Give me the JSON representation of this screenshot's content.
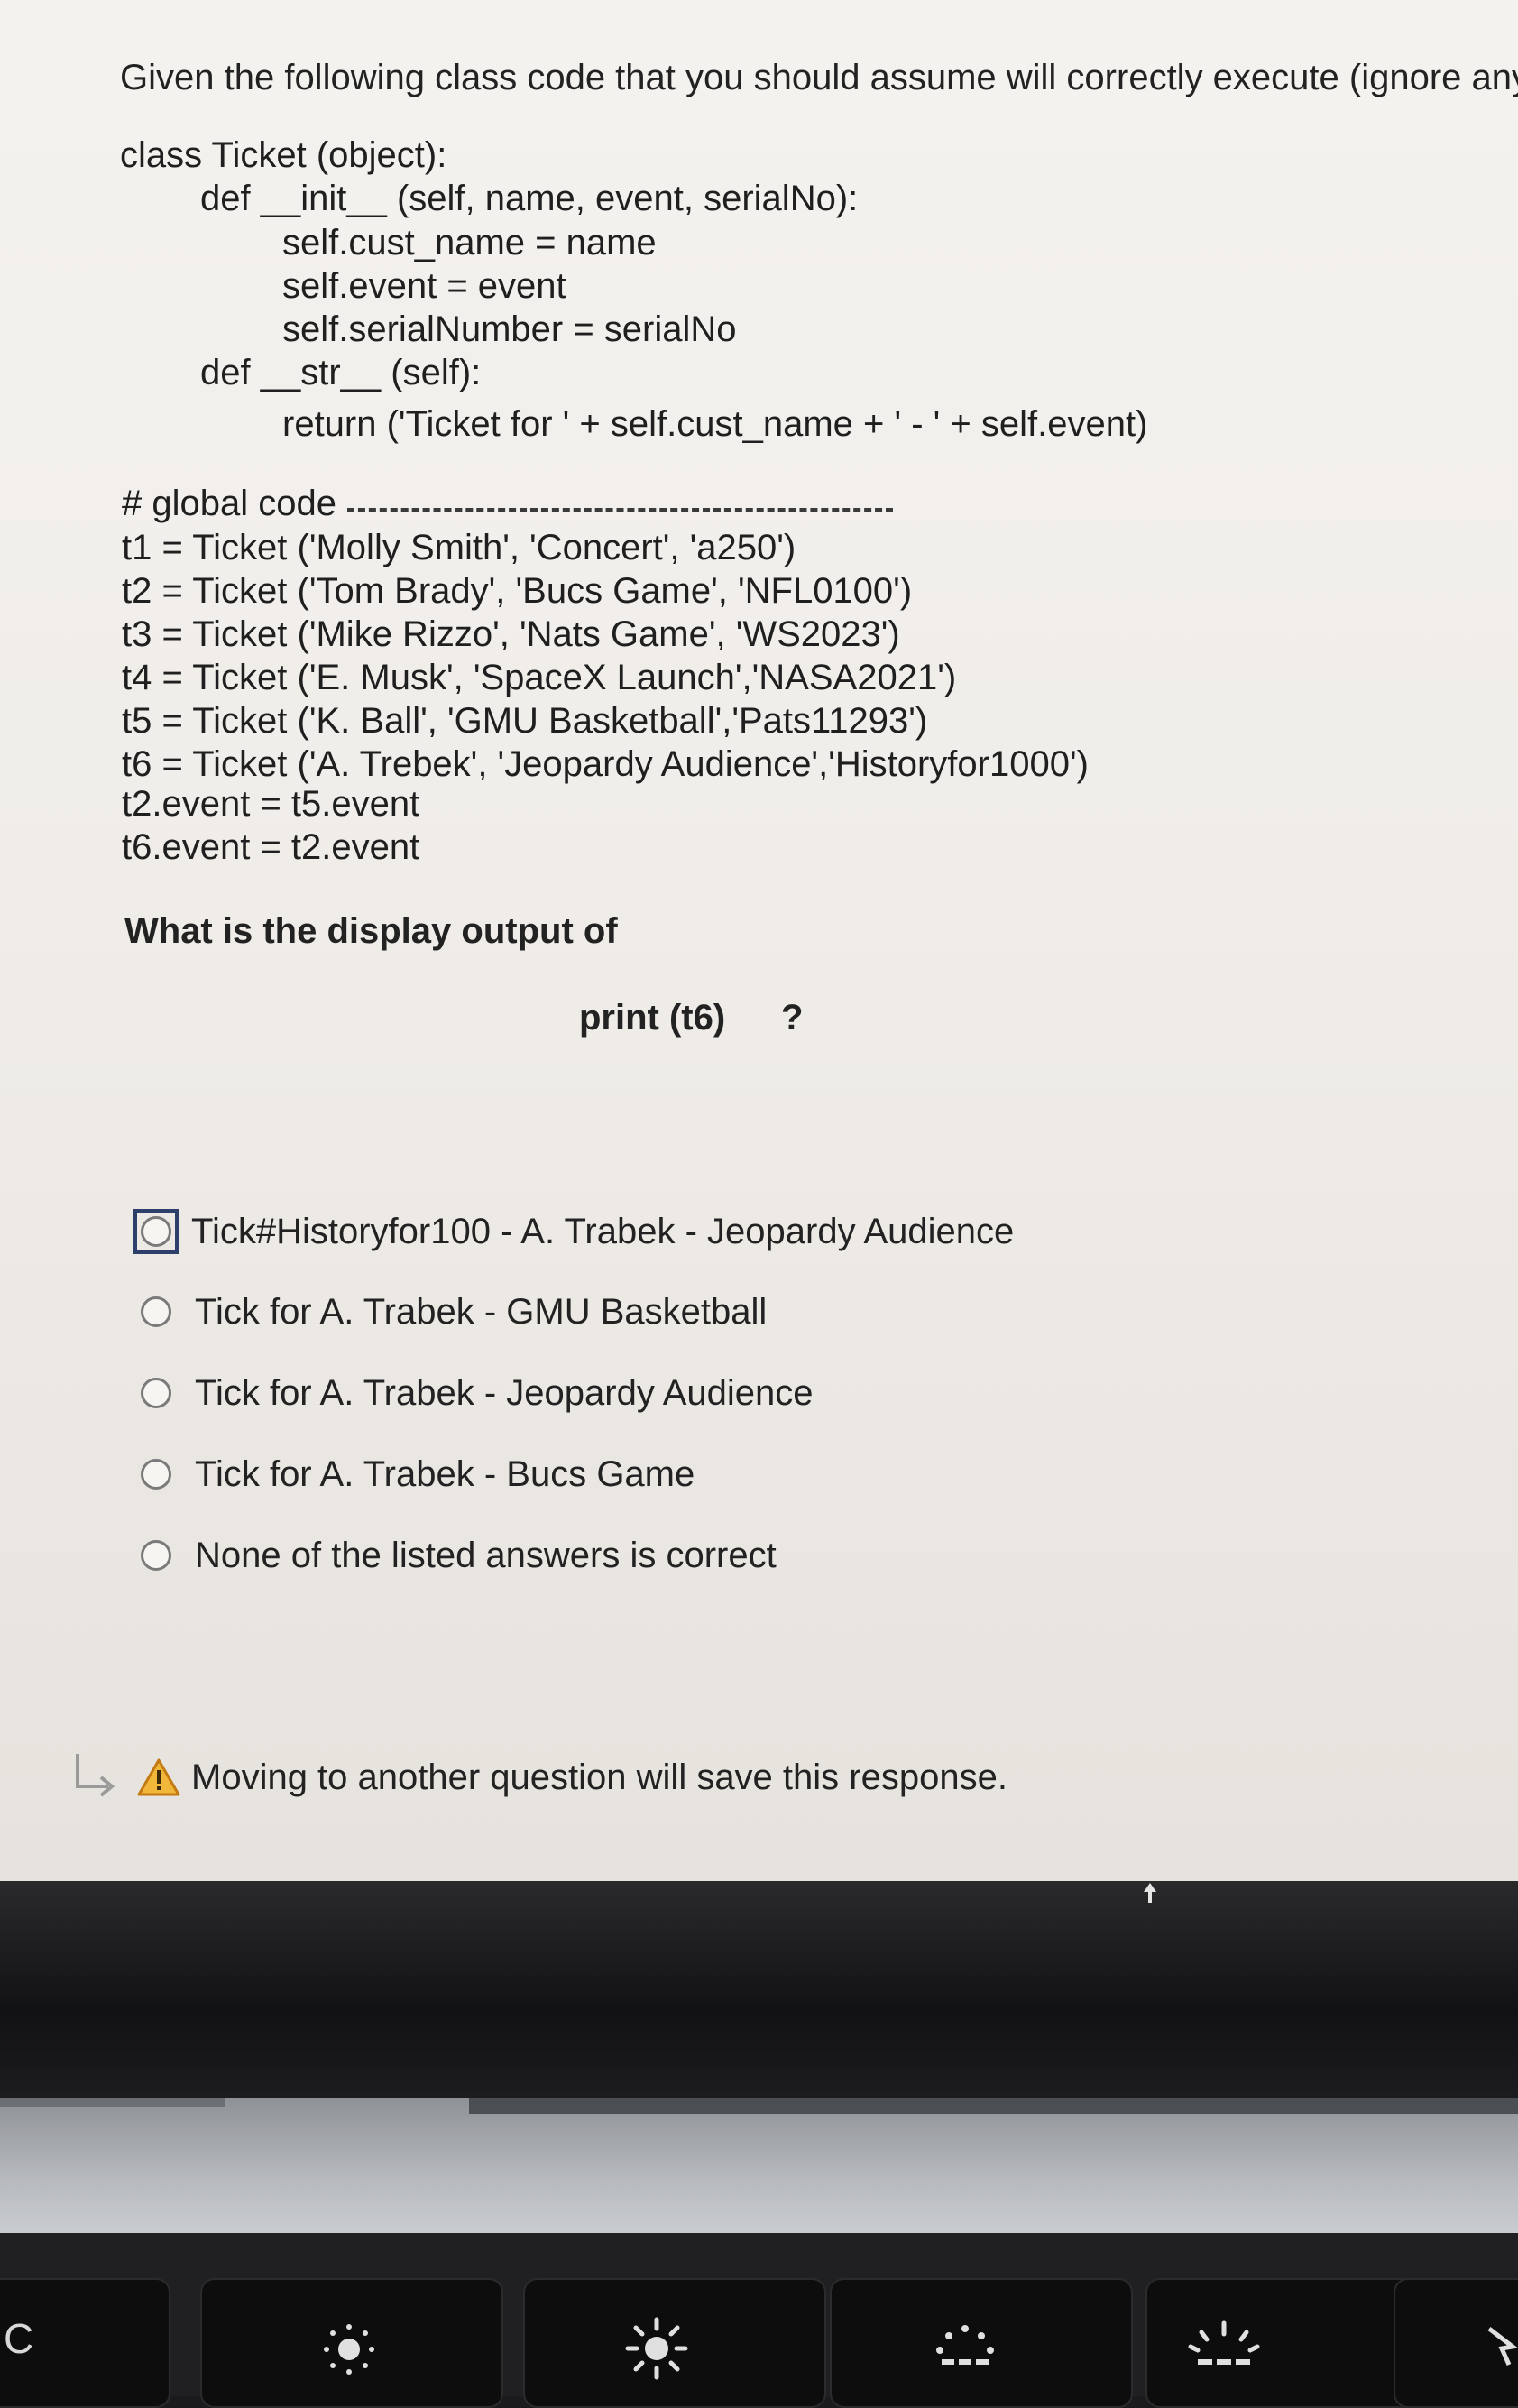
{
  "question": {
    "intro": "Given the following class code that you should assume will correctly execute (ignore any i",
    "code": [
      "class Ticket (object):",
      "def __init__ (self, name, event, serialNo):",
      "self.cust_name = name",
      "self.event = event",
      "self.serialNumber = serialNo",
      "def __str__ (self):",
      "return ('Ticket for ' + self.cust_name + ' - ' + self.event)",
      "# global code",
      "t1 = Ticket ('Molly Smith', 'Concert', 'a250')",
      "t2 = Ticket ('Tom Brady', 'Bucs Game', 'NFL0100')",
      "t3 = Ticket ('Mike Rizzo', 'Nats Game', 'WS2023')",
      "t4 = Ticket ('E. Musk', 'SpaceX Launch','NASA2021')",
      "t5 = Ticket ('K. Ball', 'GMU Basketball','Pats11293')",
      "t6 = Ticket ('A. Trebek', 'Jeopardy Audience','Historyfor1000')",
      "t2.event = t5.event",
      "t6.event = t2.event"
    ],
    "prompt": "What is the display output of",
    "print_stmt": "print (t6)",
    "qmark": "?"
  },
  "options": [
    "Tick#Historyfor100 - A. Trabek - Jeopardy Audience",
    "Tick for A. Trabek - GMU Basketball",
    "Tick for A. Trabek - Jeopardy Audience",
    "Tick for A. Trabek - Bucs Game",
    "None of the listed answers is correct"
  ],
  "focused_option_index": 0,
  "notice": "Moving to another question will save this response.",
  "keyboard": {
    "esc_label": "C"
  },
  "colors": {
    "warning": "#d99a1e",
    "focus_border": "#2d3f6a"
  }
}
